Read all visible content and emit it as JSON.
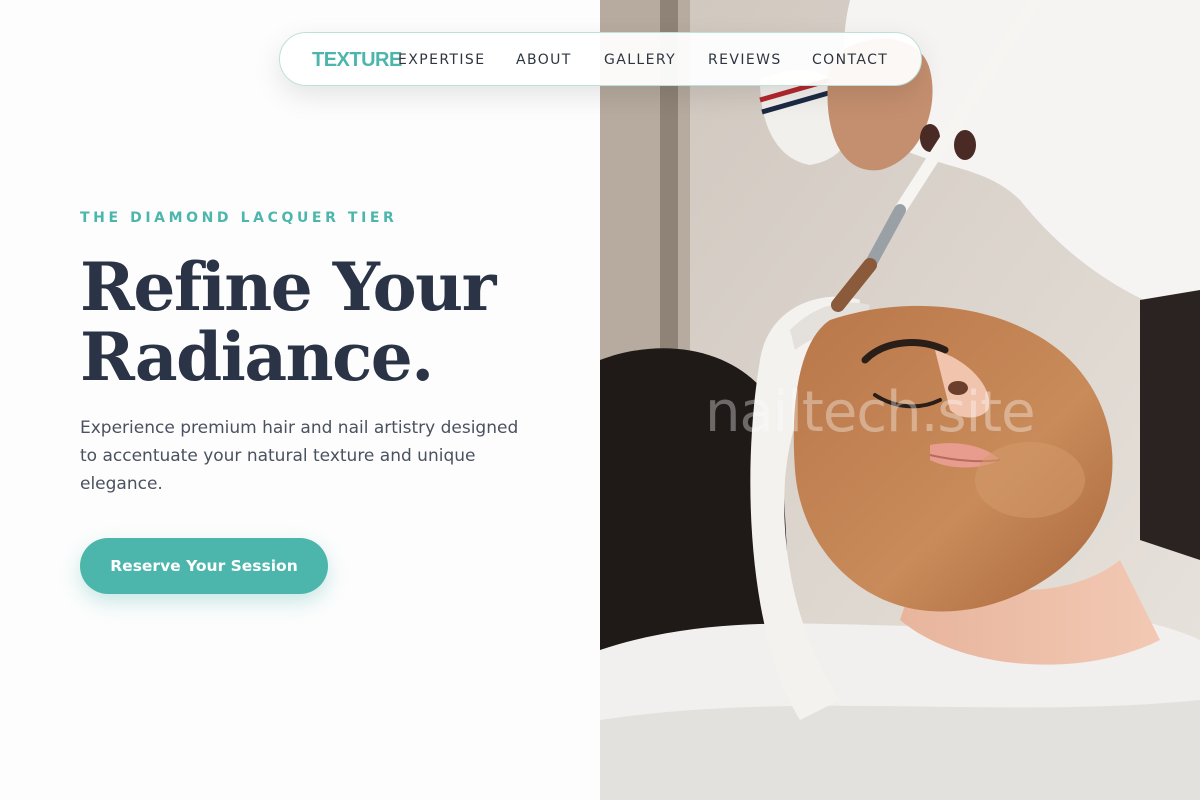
{
  "nav": {
    "brand": "TEXTURE",
    "links": [
      "EXPERTISE",
      "ABOUT",
      "GALLERY",
      "REVIEWS",
      "CONTACT"
    ]
  },
  "hero": {
    "kicker": "THE DIAMOND LACQUER TIER",
    "headline_lines": [
      "Refine Your",
      "Radiance."
    ],
    "description": "Experience premium hair and nail artistry designed to accentuate your natural texture and unique elegance.",
    "cta_label": "Reserve Your Session"
  },
  "image": {
    "watermark": "nailtech.site"
  },
  "colors": {
    "accent": "#4db6ac",
    "heading": "#2b3446",
    "body_text": "#4a5160"
  }
}
